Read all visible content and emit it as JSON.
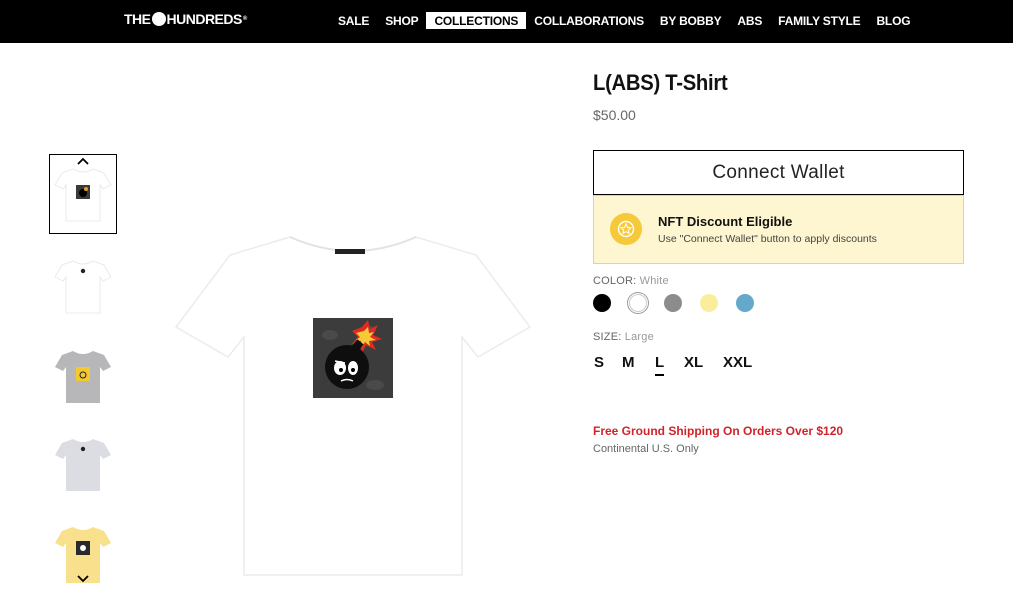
{
  "header": {
    "logo_left": "THE",
    "logo_right": "HUNDREDS",
    "logo_mark": "®",
    "nav": [
      {
        "label": "SALE"
      },
      {
        "label": "SHOP"
      },
      {
        "label": "COLLECTIONS",
        "active": true
      },
      {
        "label": "COLLABORATIONS"
      },
      {
        "label": "BY BOBBY"
      },
      {
        "label": "ABS"
      },
      {
        "label": "FAMILY STYLE"
      },
      {
        "label": "BLOG"
      }
    ]
  },
  "gallery": {
    "thumbnails": [
      {
        "shirt_color": "#ffffff",
        "graphic": "bomb-print",
        "selected": true
      },
      {
        "shirt_color": "#ffffff",
        "graphic": "small-chest",
        "selected": false
      },
      {
        "shirt_color": "#b7b7b9",
        "graphic": "yellow-print",
        "selected": false
      },
      {
        "shirt_color": "#dcdde2",
        "graphic": "small-chest",
        "selected": false
      },
      {
        "shirt_color": "#f8e08c",
        "graphic": "bomb-print",
        "selected": false
      }
    ]
  },
  "product": {
    "title": "L(ABS) T-Shirt",
    "price": "$50.00",
    "connect_wallet_label": "Connect Wallet",
    "nft": {
      "title": "NFT Discount Eligible",
      "subtitle": "Use \"Connect Wallet\" button to apply discounts"
    },
    "color_label": "COLOR:",
    "color_value": "White",
    "colors": [
      {
        "name": "black",
        "hex": "#000000"
      },
      {
        "name": "white",
        "hex": "#ffffff",
        "selected": true
      },
      {
        "name": "grey",
        "hex": "#8c8c8c"
      },
      {
        "name": "yellow",
        "hex": "#f8ee9c"
      },
      {
        "name": "blue",
        "hex": "#64a8cc"
      }
    ],
    "size_label": "SIZE:",
    "size_value": "Large",
    "sizes": [
      "S",
      "M",
      "L",
      "XL",
      "XXL"
    ],
    "selected_size": "L",
    "shipping": "Free Ground Shipping On Orders Over $120",
    "shipping_note": "Continental U.S. Only"
  }
}
